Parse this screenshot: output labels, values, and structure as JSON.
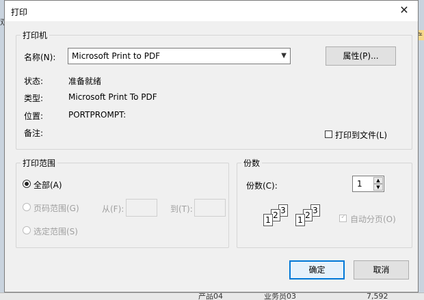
{
  "background": {
    "top_text": "双",
    "right_text": "产",
    "cells": [
      "产品04",
      "业务员03",
      "7,592"
    ]
  },
  "dialog": {
    "title": "打印",
    "printer_group": {
      "legend": "打印机",
      "name_label": "名称(N):",
      "name_value": "Microsoft Print to PDF",
      "properties_button": "属性(P)...",
      "status_label": "状态:",
      "status_value": "准备就绪",
      "type_label": "类型:",
      "type_value": "Microsoft Print To PDF",
      "location_label": "位置:",
      "location_value": "PORTPROMPT:",
      "comment_label": "备注:",
      "print_to_file_label": "打印到文件(L)"
    },
    "range_group": {
      "legend": "打印范围",
      "all_label": "全部(A)",
      "pages_label": "页码范围(G)",
      "from_label": "从(F):",
      "to_label": "到(T):",
      "selection_label": "选定范围(S)"
    },
    "copies_group": {
      "legend": "份数",
      "copies_label": "份数(C):",
      "copies_value": "1",
      "collate_label": "自动分页(O)",
      "collate_pages": [
        "1",
        "2",
        "3"
      ]
    },
    "ok_button": "确定",
    "cancel_button": "取消"
  }
}
